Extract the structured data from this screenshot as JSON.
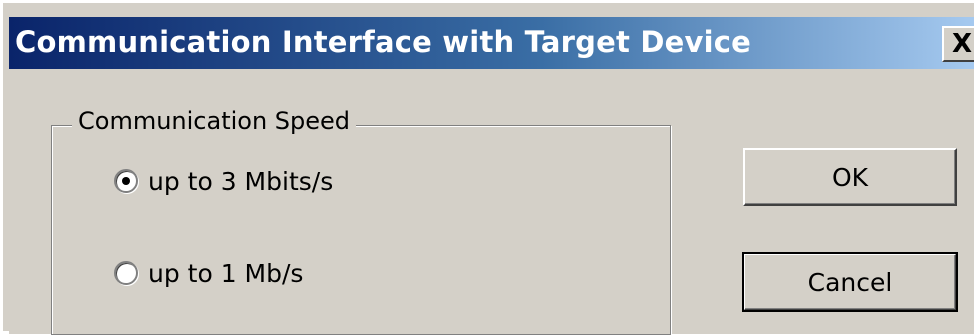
{
  "window": {
    "title": "Communication Interface with Target Device",
    "close_glyph": "X"
  },
  "group": {
    "label": "Communication Speed",
    "options": [
      {
        "label": "up to 3 Mbits/s",
        "checked": true
      },
      {
        "label": "up to 1 Mb/s",
        "checked": false
      }
    ]
  },
  "buttons": {
    "ok": "OK",
    "cancel": "Cancel"
  }
}
